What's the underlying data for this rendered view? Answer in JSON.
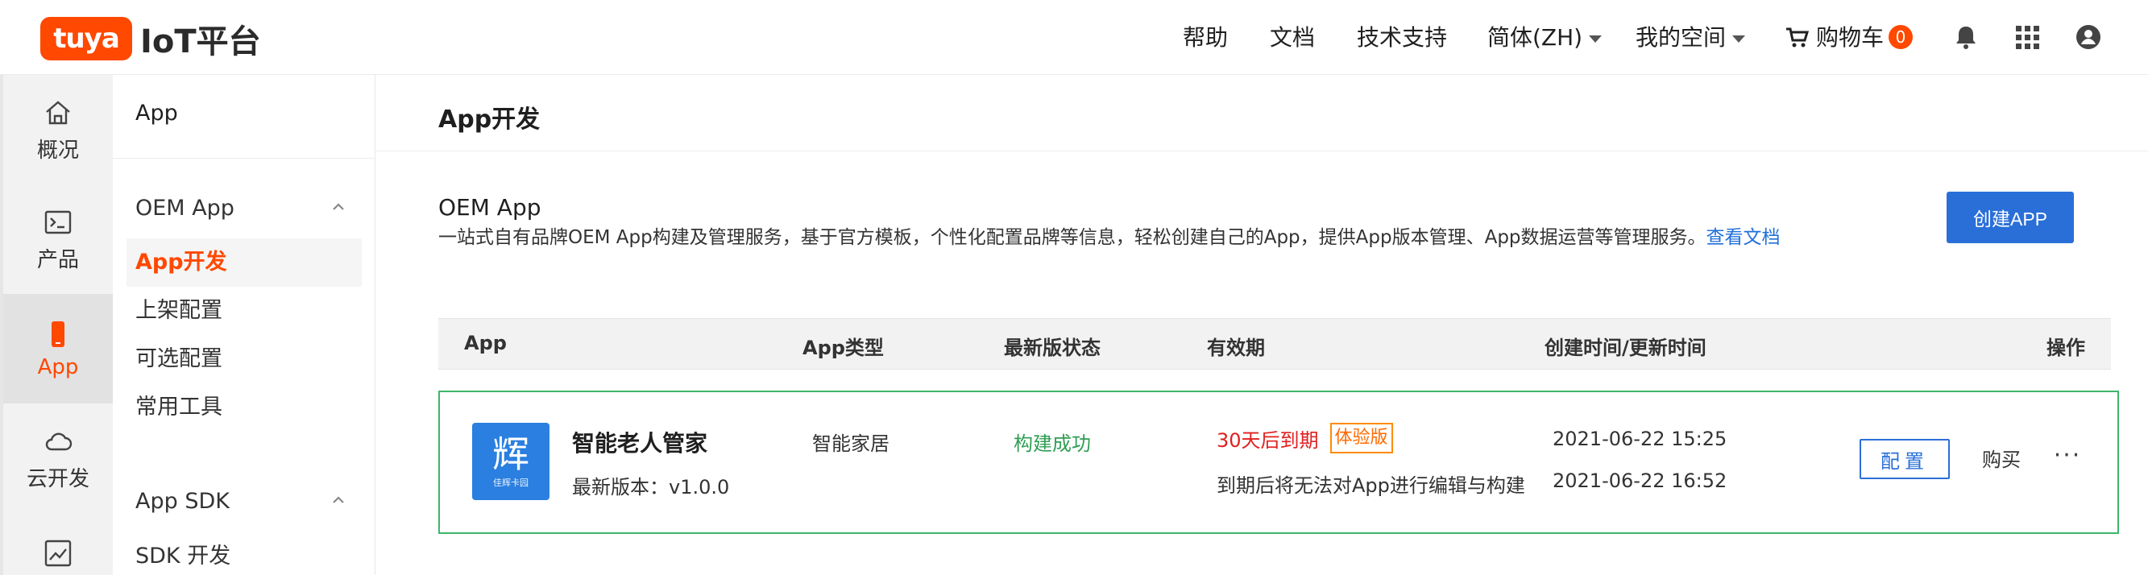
{
  "header": {
    "logo_badge": "tuya",
    "logo_text": "IoT平台",
    "nav": {
      "help": "帮助",
      "docs": "文档",
      "support": "技术支持",
      "language": "简体(ZH)",
      "workspace": "我的空间",
      "cart": "购物车",
      "cart_count": "0"
    },
    "icons": [
      "cart-icon",
      "bell-icon",
      "apps-grid-icon",
      "user-icon"
    ]
  },
  "rail": {
    "items": [
      {
        "label": "概况",
        "icon": "home-icon"
      },
      {
        "label": "产品",
        "icon": "terminal-icon"
      },
      {
        "label": "App",
        "icon": "phone-icon"
      },
      {
        "label": "云开发",
        "icon": "cloud-icon"
      }
    ]
  },
  "submenu": {
    "title": "App",
    "groups": [
      {
        "label": "OEM App",
        "items": [
          "App开发",
          "上架配置",
          "可选配置",
          "常用工具"
        ]
      },
      {
        "label": "App SDK",
        "items": [
          "SDK 开发"
        ]
      }
    ]
  },
  "main": {
    "page_title": "App开发",
    "section_title": "OEM App",
    "section_desc": "一站式自有品牌OEM App构建及管理服务，基于官方模板，个性化配置品牌等信息，轻松创建自己的App，提供App版本管理、App数据运营等管理服务。",
    "section_link": "查看文档",
    "create_button": "创建APP",
    "table": {
      "headers": [
        "App",
        "App类型",
        "最新版状态",
        "有效期",
        "创建时间/更新时间",
        "操作"
      ],
      "rows": [
        {
          "icon_glyph": "辉",
          "icon_sub": "佳辉卡园",
          "name": "智能老人管家",
          "version": "最新版本：v1.0.0",
          "type": "智能家居",
          "status": "构建成功",
          "expire": "30天后到期",
          "tag": "体验版",
          "expire_note": "到期后将无法对App进行编辑与构建",
          "created": "2021-06-22 15:25",
          "updated": "2021-06-22 16:52",
          "config": "配置",
          "buy": "购买",
          "more": "···"
        }
      ]
    }
  },
  "colors": {
    "brand": "#ff4800",
    "primary": "#2a6fd8",
    "success": "#2f9e53",
    "danger": "#e02020"
  }
}
